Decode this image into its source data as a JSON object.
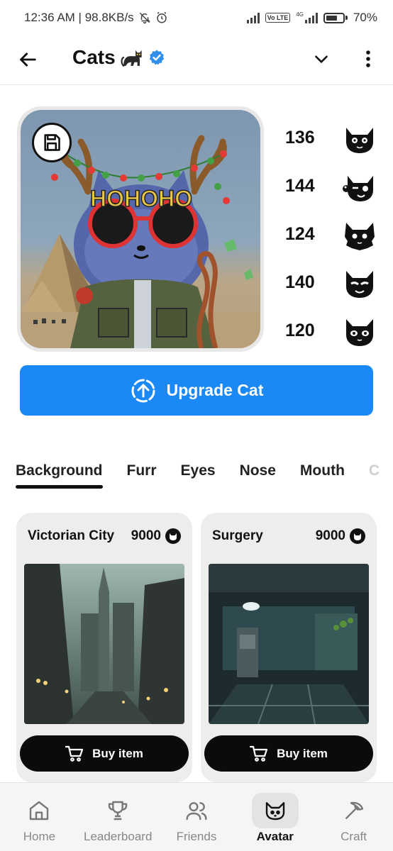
{
  "status_bar": {
    "time_speed": "12:36 AM | 98.8KB/s",
    "volte": "Vo LTE",
    "network": "4G",
    "battery": "70%",
    "battery_level": 0.7
  },
  "header": {
    "title": "Cats",
    "back_icon": "arrow-left-icon",
    "verified_icon": "verified-badge-icon",
    "dropdown_icon": "chevron-down-icon",
    "menu_icon": "more-vertical-icon"
  },
  "avatar": {
    "glasses_text": "HOHOHO",
    "save_icon": "save-icon"
  },
  "stats": [
    {
      "value": "136",
      "icon": "cat-face-sparkle-icon"
    },
    {
      "value": "144",
      "icon": "cat-face-wink-icon"
    },
    {
      "value": "124",
      "icon": "cat-face-fluffy-icon"
    },
    {
      "value": "140",
      "icon": "cat-face-smug-icon"
    },
    {
      "value": "120",
      "icon": "cat-face-starry-icon"
    }
  ],
  "upgrade": {
    "label": "Upgrade Cat",
    "icon": "upgrade-arrow-icon"
  },
  "tabs": [
    {
      "label": "Background",
      "active": true
    },
    {
      "label": "Furr"
    },
    {
      "label": "Eyes"
    },
    {
      "label": "Nose"
    },
    {
      "label": "Mouth"
    },
    {
      "label": "C"
    }
  ],
  "items": [
    {
      "name": "Victorian City",
      "price": "9000",
      "buy_label": "Buy item"
    },
    {
      "name": "Surgery",
      "price": "9000",
      "buy_label": "Buy item"
    }
  ],
  "nav": [
    {
      "label": "Home",
      "icon": "home-icon"
    },
    {
      "label": "Leaderboard",
      "icon": "trophy-icon"
    },
    {
      "label": "Friends",
      "icon": "friends-icon"
    },
    {
      "label": "Avatar",
      "icon": "cat-avatar-icon",
      "active": true
    },
    {
      "label": "Craft",
      "icon": "pickaxe-icon"
    }
  ],
  "colors": {
    "accent": "#1a88f5",
    "verified": "#2f8fea",
    "dark": "#0b0b0b"
  }
}
